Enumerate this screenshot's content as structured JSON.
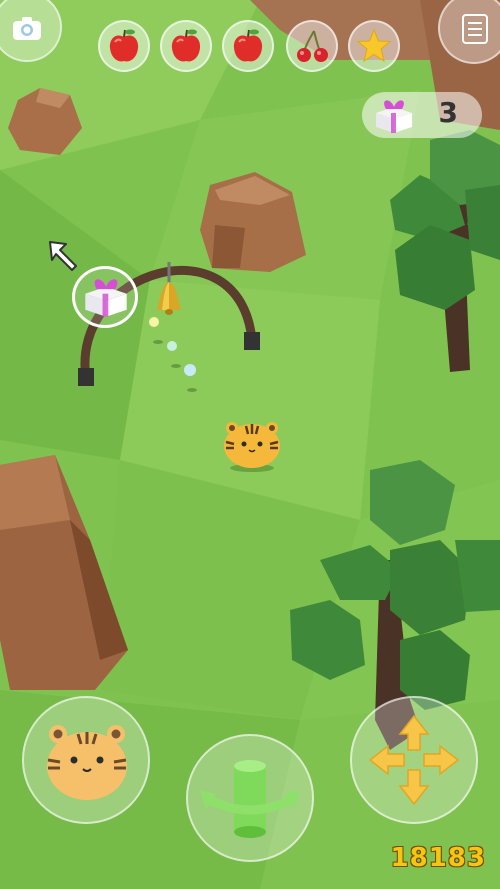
{
  "hud": {
    "camera_button": {
      "icon": "camera-icon"
    },
    "menu_button": {
      "icon": "menu-list-icon"
    },
    "collectibles": [
      {
        "name": "apple",
        "icon": "apple-icon"
      },
      {
        "name": "apple",
        "icon": "apple-icon"
      },
      {
        "name": "apple",
        "icon": "apple-icon"
      },
      {
        "name": "cherry",
        "icon": "cherry-icon"
      },
      {
        "name": "star",
        "icon": "star-icon"
      }
    ],
    "gift_counter": {
      "icon": "gift-box-icon",
      "count": "3"
    }
  },
  "world": {
    "target_marker": {
      "icon": "gift-box-icon"
    },
    "direction_hint": {
      "icon": "arrow-up-left-icon"
    },
    "bell": {
      "icon": "bell-icon"
    },
    "player": {
      "character": "tiger"
    }
  },
  "controls": {
    "character_button": {
      "icon": "tiger-avatar-icon"
    },
    "rotate_camera_button": {
      "icon": "rotate-cylinder-icon"
    },
    "dpad": {
      "icon": "four-way-arrows-icon"
    }
  },
  "watermark": {
    "text": "18183"
  },
  "colors": {
    "grass": "#7cbf4f",
    "grass_light": "#9bd36a",
    "rock": "#a06a45",
    "tree_leaf": "#3f8a3a",
    "tree_trunk": "#4a3326",
    "arrow_yellow": "#f7c548",
    "tiger_orange": "#f5b83a"
  }
}
